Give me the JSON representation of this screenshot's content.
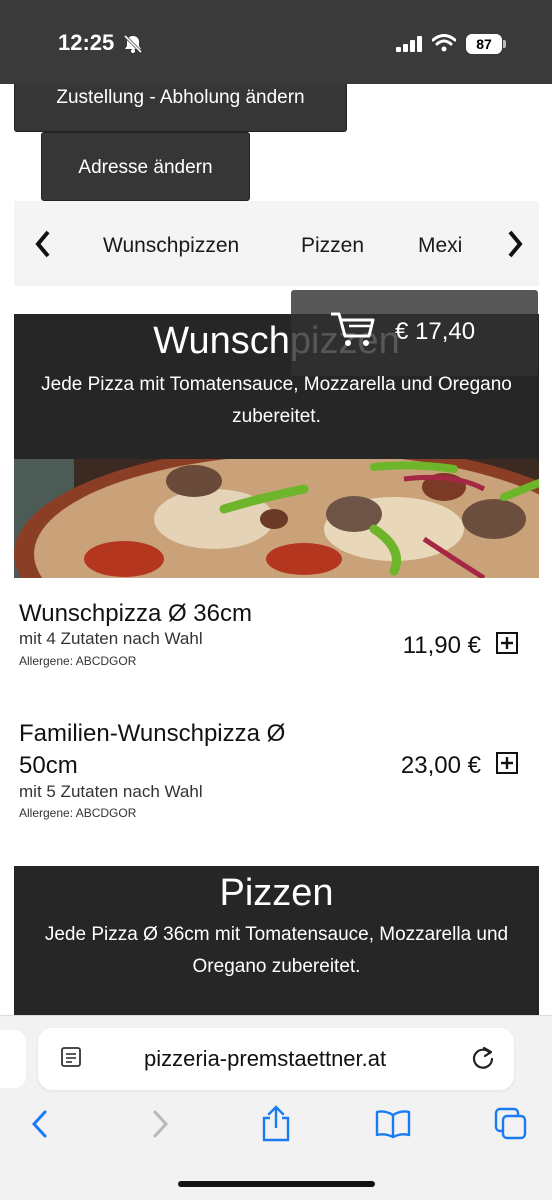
{
  "status_bar": {
    "time": "12:25",
    "battery": "87"
  },
  "buttons": {
    "delivery_pickup": "Zustellung - Abholung ändern",
    "change_address": "Adresse ändern"
  },
  "category_nav": {
    "items": [
      "Wunschpizzen",
      "Pizzen",
      "Mexi"
    ]
  },
  "cart": {
    "total": "€ 17,40"
  },
  "sections": [
    {
      "title": "Wunschpizzen",
      "description": "Jede Pizza mit Tomatensauce, Mozzarella und Oregano zubereitet.",
      "products": [
        {
          "name": "Wunschpizza Ø 36cm",
          "subtitle": "mit 4 Zutaten nach Wahl",
          "allergens": "Allergene: ABCDGOR",
          "price": "11,90 €"
        },
        {
          "name": "Familien-Wunschpizza Ø 50cm",
          "subtitle": "mit 5 Zutaten nach Wahl",
          "allergens": "Allergene: ABCDGOR",
          "price": "23,00 €"
        }
      ]
    },
    {
      "title": "Pizzen",
      "description": "Jede Pizza Ø 36cm mit Tomatensauce, Mozzarella und Oregano zubereitet."
    }
  ],
  "browser": {
    "url": "pizzeria-premstaettner.at"
  },
  "icons": {
    "bell_muted": "bell-slash-icon",
    "signal": "cellular-signal-icon",
    "wifi": "wifi-icon",
    "cart": "shopping-cart-icon",
    "add": "plus-square-icon",
    "reader": "reader-mode-icon",
    "reload": "reload-icon",
    "back": "chevron-left-icon",
    "forward": "chevron-right-icon",
    "share": "share-icon",
    "bookmarks": "book-icon",
    "tabs": "tabs-icon"
  }
}
